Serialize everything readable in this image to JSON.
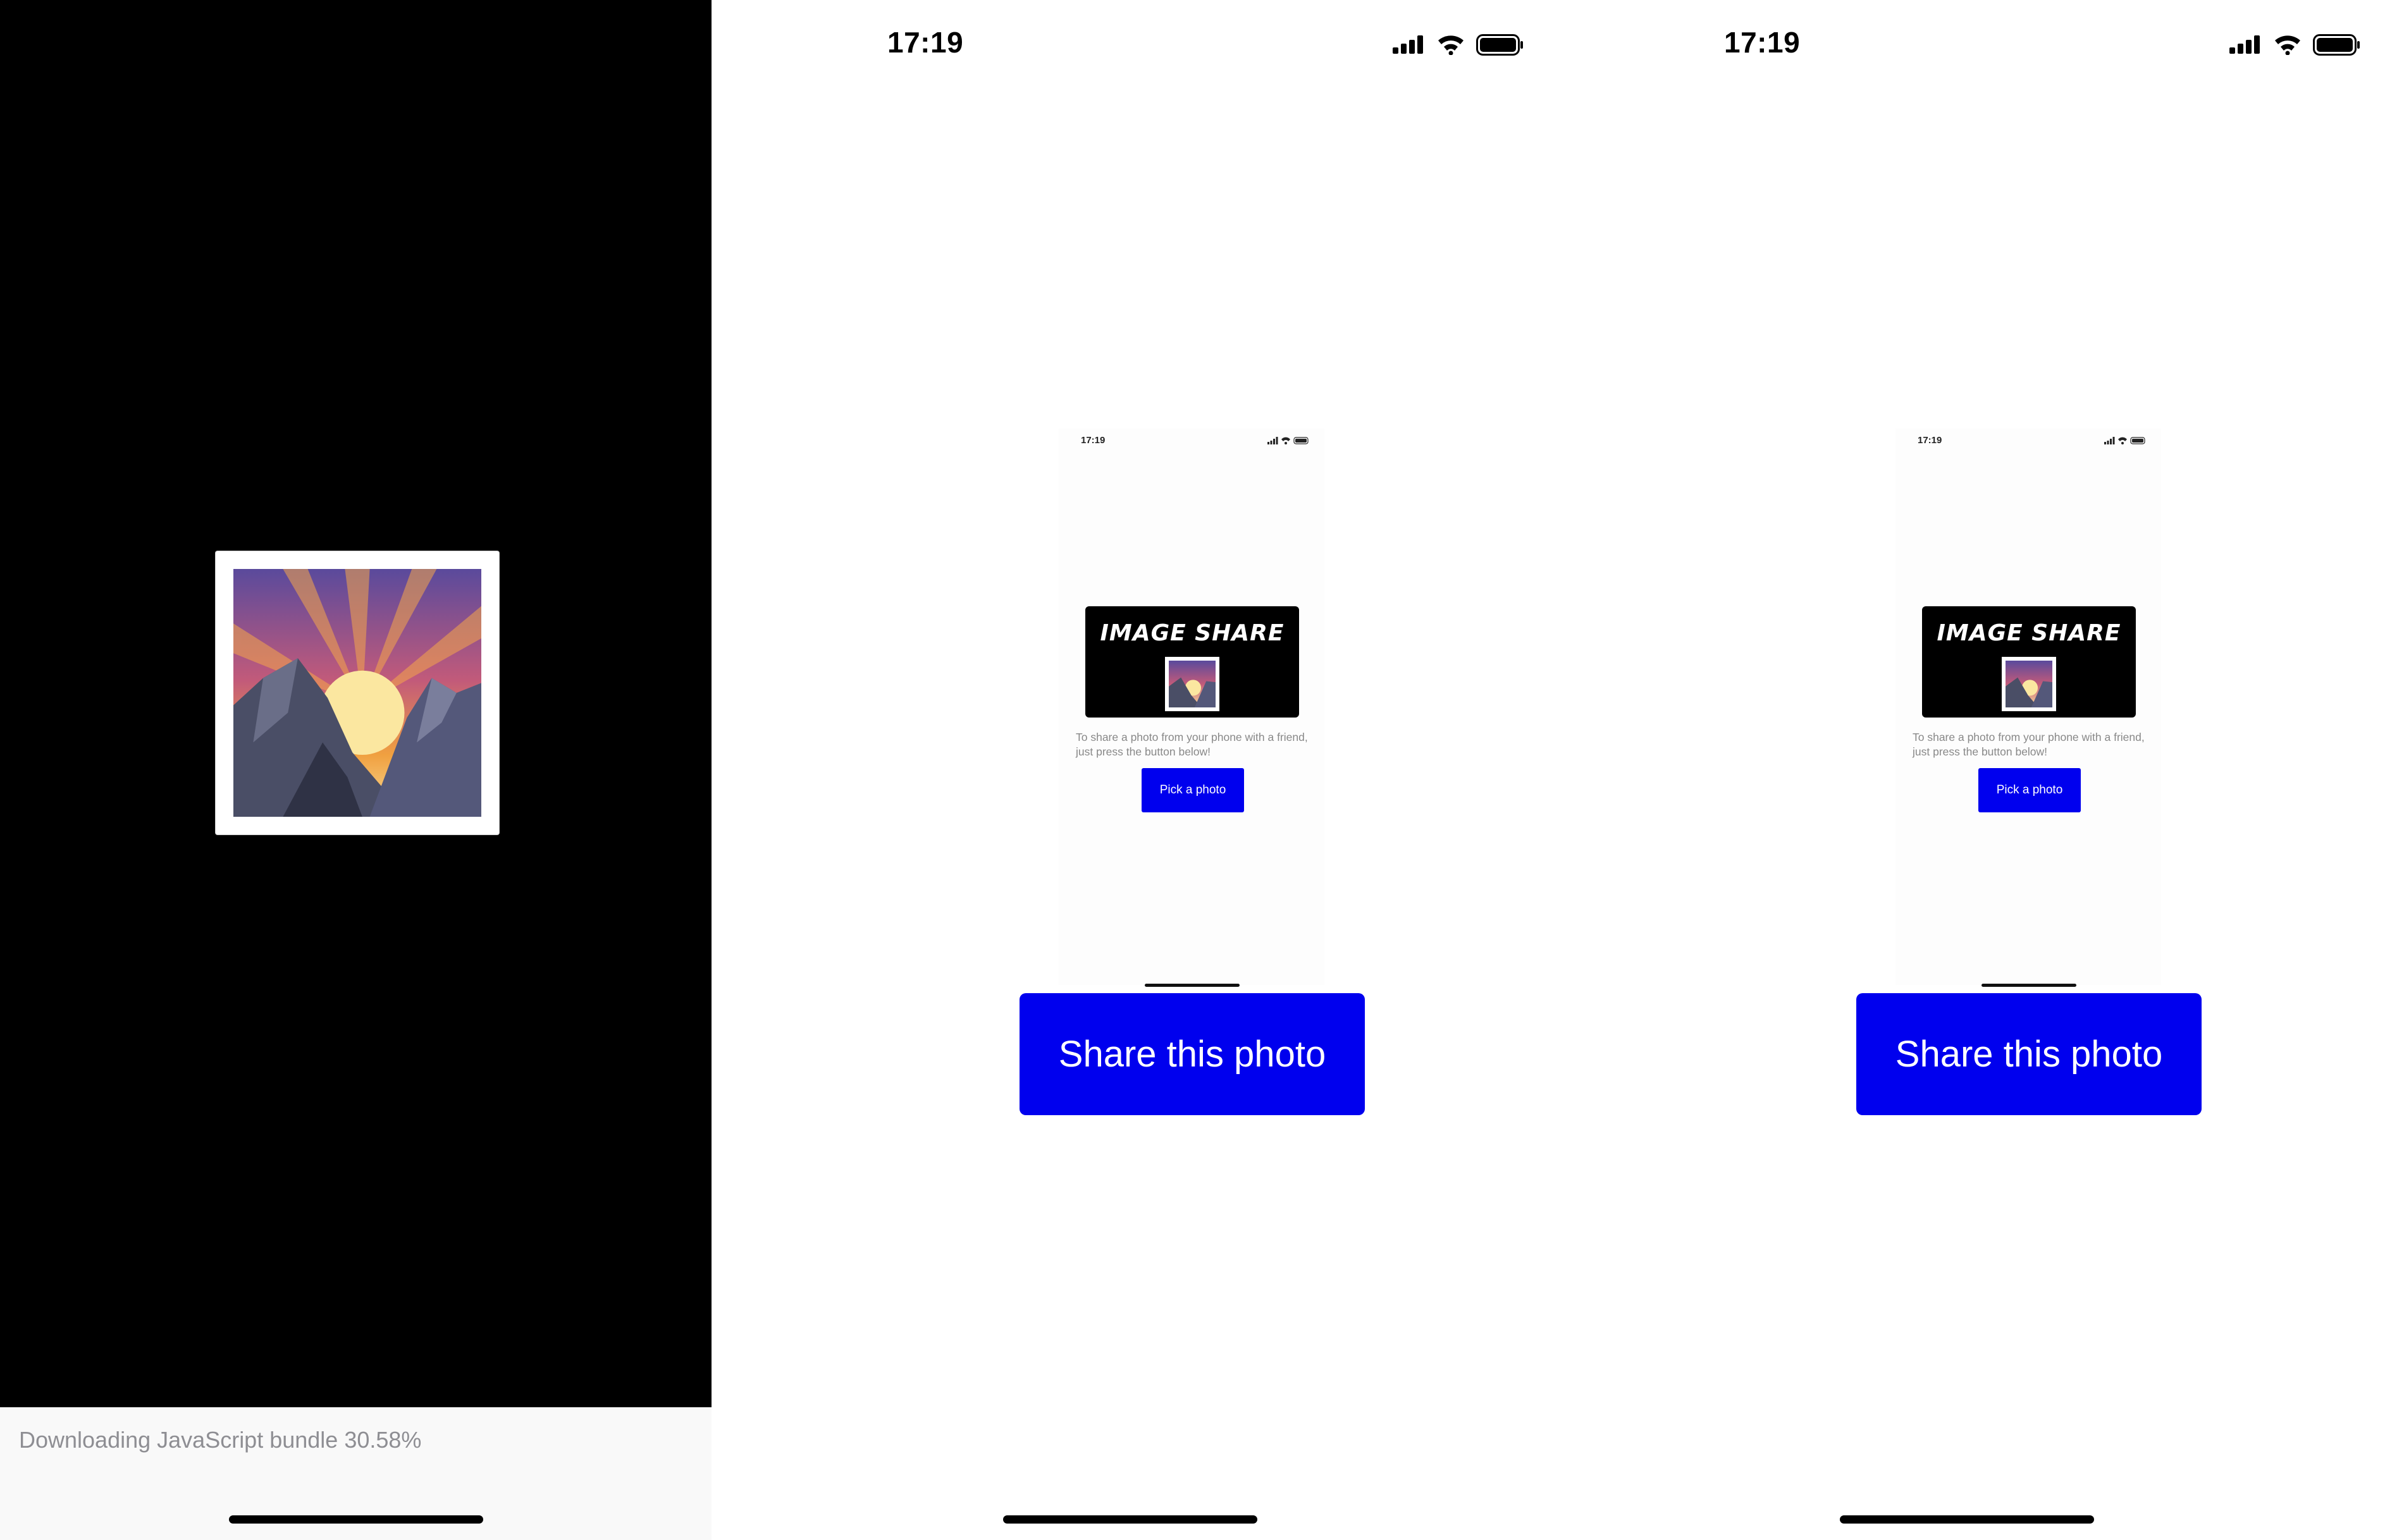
{
  "splash": {
    "loading_text": "Downloading JavaScript bundle 30.58%",
    "progress_percent": 30.58,
    "icon": "sunrise-over-mountains-icon"
  },
  "screens": [
    {
      "status": {
        "time": "17:19",
        "icons": [
          "cellular-signal-icon",
          "wifi-icon",
          "battery-icon"
        ]
      },
      "preview": {
        "time": "17:19",
        "logo_title": "IMAGE SHARE",
        "instructions": "To share a photo from your phone with a friend, just press the button below!",
        "pick_button": "Pick a photo"
      },
      "share_button": "Share this photo"
    },
    {
      "status": {
        "time": "17:19",
        "icons": [
          "cellular-signal-icon",
          "wifi-icon",
          "battery-icon"
        ]
      },
      "preview": {
        "time": "17:19",
        "logo_title": "IMAGE SHARE",
        "instructions": "To share a photo from your phone with a friend, just press the button below!",
        "pick_button": "Pick a photo"
      },
      "share_button": "Share this photo"
    }
  ],
  "colors": {
    "accent": "#0000ee",
    "splash_bg": "#000000",
    "loader_bg": "#f9f9f9"
  }
}
